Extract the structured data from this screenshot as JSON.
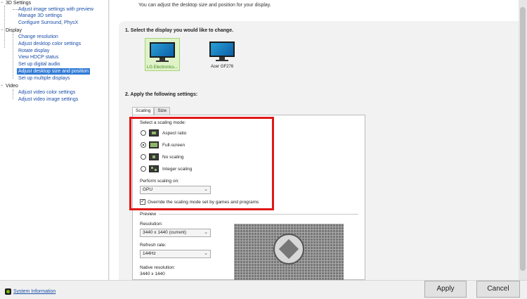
{
  "tree": {
    "categories": [
      {
        "label": "3D Settings",
        "items": [
          "Adjust image settings with preview",
          "Manage 3D settings",
          "Configure Surround, PhysX"
        ]
      },
      {
        "label": "Display",
        "items": [
          "Change resolution",
          "Adjust desktop color settings",
          "Rotate display",
          "View HDCP status",
          "Set up digital audio",
          "Adjust desktop size and position",
          "Set up multiple displays"
        ]
      },
      {
        "label": "Video",
        "items": [
          "Adjust video color settings",
          "Adjust video image settings"
        ]
      }
    ],
    "expander": "−"
  },
  "main": {
    "description": "You can adjust the desktop size and position for your display.",
    "step1": "1. Select the display you would like to change.",
    "displays": [
      "LG Electronics...",
      "Acer GF276"
    ],
    "step2": "2. Apply the following settings:",
    "tabs": [
      "Scaling",
      "Size"
    ],
    "scaling": {
      "mode_label": "Select a scaling mode:",
      "modes": [
        "Aspect ratio",
        "Full-screen",
        "No scaling",
        "Integer scaling"
      ],
      "selected_mode": "Full-screen",
      "perform_label": "Perform scaling on:",
      "perform_value": "GPU",
      "override_label": "Override the scaling mode set by games and programs",
      "override_checked": true
    },
    "preview": {
      "legend": "Preview",
      "resolution_label": "Resolution:",
      "resolution_value": "3440 x 1440 (current)",
      "refresh_label": "Refresh rate:",
      "refresh_value": "144Hz",
      "native_label": "Native resolution:",
      "native_value": "3440 x 1440"
    }
  },
  "footer": {
    "system_info": "System Information",
    "apply": "Apply",
    "cancel": "Cancel"
  },
  "icons": {
    "dropdown": "⌄",
    "check": "✓"
  },
  "colors": {
    "highlight_box": "#e01818",
    "selection": "#2f7ad6",
    "selected_display": "#3b8a1a"
  }
}
